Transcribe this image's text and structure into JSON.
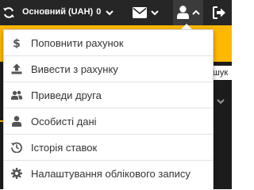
{
  "topbar": {
    "balance_label": "Основний (UAH)",
    "balance_amount": "0"
  },
  "background": {
    "search_text": "Пошук"
  },
  "account_menu": {
    "items": [
      {
        "label": "Поповнити рахунок",
        "icon": "dollar-icon"
      },
      {
        "label": "Вивести з рахунку",
        "icon": "upload-icon"
      },
      {
        "label": "Приведи друга",
        "icon": "users-icon"
      },
      {
        "label": "Особисті дані",
        "icon": "user-icon"
      },
      {
        "label": "Історія ставок",
        "icon": "history-icon"
      },
      {
        "label": "Налаштування облікового запису",
        "icon": "gear-icon"
      }
    ]
  },
  "colors": {
    "topbar_bg": "#262626",
    "accent_yellow": "#ffb800",
    "menu_icon": "#555555"
  }
}
